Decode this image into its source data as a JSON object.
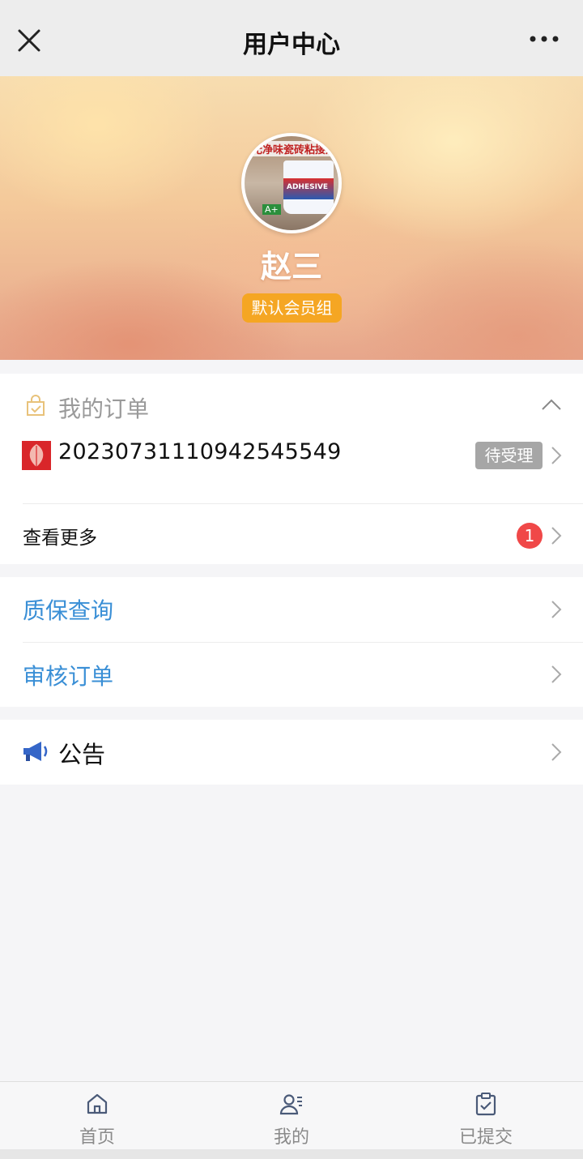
{
  "navbar": {
    "title": "用户中心",
    "close_icon": "close-icon",
    "more_icon": "more-icon"
  },
  "profile": {
    "avatar_text": "无净味瓷砖粘接剂",
    "avatar_product_label": "ADHESIVE",
    "avatar_grade": "A+",
    "name": "赵三",
    "member_group": "默认会员组"
  },
  "orders": {
    "title": "我的订单",
    "icon": "order-bag-icon",
    "collapse_icon": "chevron-up-icon",
    "items": [
      {
        "order_number": "20230731110942545549",
        "status": "待受理",
        "thumb_icon": "leaf-icon"
      }
    ],
    "view_more_label": "查看更多",
    "view_more_count": "1"
  },
  "links": {
    "items": [
      {
        "label": "质保查询"
      },
      {
        "label": "审核订单"
      }
    ]
  },
  "notice": {
    "label": "公告",
    "icon": "megaphone-icon"
  },
  "tabbar": {
    "tabs": [
      {
        "label": "首页",
        "icon": "home-icon"
      },
      {
        "label": "我的",
        "icon": "user-icon"
      },
      {
        "label": "已提交",
        "icon": "clipboard-check-icon"
      }
    ]
  },
  "colors": {
    "accent_blue": "#3a8fd6",
    "badge_orange": "#f5a623",
    "status_grey": "#a6a6a6",
    "count_red": "#f04848"
  }
}
